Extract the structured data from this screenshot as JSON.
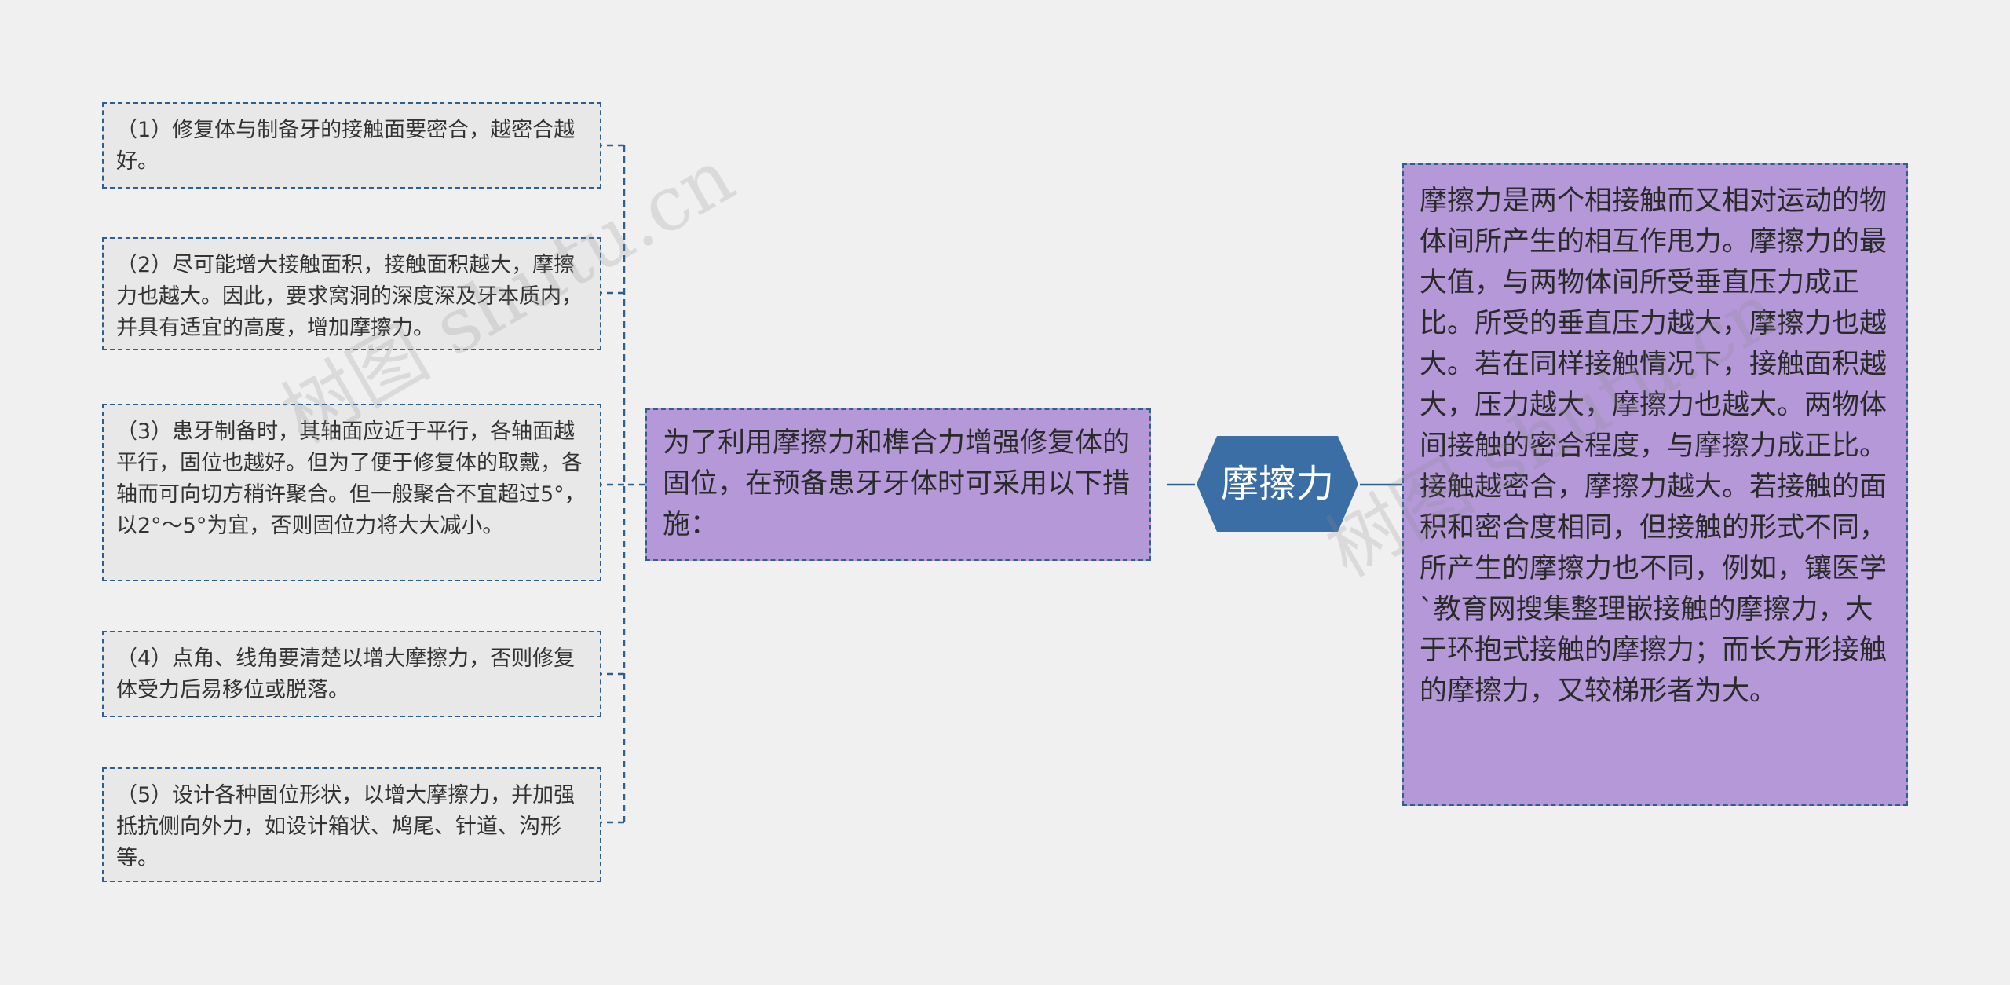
{
  "central": {
    "label": "摩擦力"
  },
  "definition": {
    "text": "摩擦力是两个相接触而又相对运动的物体间所产生的相互作甩力。摩擦力的最大值，与两物体间所受垂直压力成正比。所受的垂直压力越大，摩擦力也越大。若在同样接触情况下，接触面积越大，压力越大，摩擦力也越大。两物体间接触的密合程度，与摩擦力成正比。接触越密合，摩擦力越大。若接触的面积和密合度相同，但接触的形式不同，所产生的摩擦力也不同，例如，镶医学`教育网搜集整理嵌接触的摩擦力，大于环抱式接触的摩擦力；而长方形接触的摩擦力，又较梯形者为大。"
  },
  "measures": {
    "intro": "为了利用摩擦力和榫合力增强修复体的固位，在预备患牙牙体时可采用以下措施：",
    "items": [
      "（1）修复体与制备牙的接触面要密合，越密合越好。",
      "（2）尽可能增大接触面积，接触面积越大，摩擦力也越大。因此，要求窝洞的深度深及牙本质内，并具有适宜的高度，增加摩擦力。",
      "（3）患牙制备时，其轴面应近于平行，各轴面越平行，固位也越好。但为了便于修复体的取戴，各轴而可向切方稍许聚合。但一般聚合不宜超过5°，以2°～5°为宜，否则固位力将大大减小。",
      "（4）点角、线角要清楚以增大摩擦力，否则修复体受力后易移位或脱落。",
      "（5）设计各种固位形状，以增大摩擦力，并加强抵抗侧向外力，如设计箱状、鸠尾、针道、沟形等。"
    ]
  },
  "watermarks": [
    "树图 shutu.cn",
    "树图 shutu.cn"
  ],
  "colors": {
    "background": "#f0f0f0",
    "central_fill": "#3a6ea5",
    "purple_fill": "#b498d8",
    "leaf_fill": "#e8e8e8",
    "connector": "#2f5f8f"
  }
}
